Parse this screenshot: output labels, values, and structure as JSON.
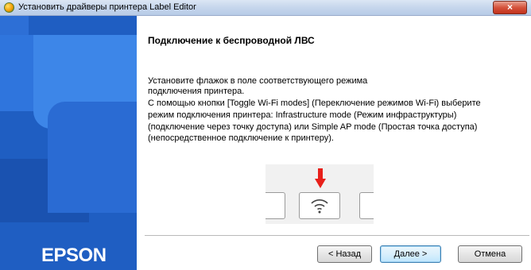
{
  "window": {
    "title": "Установить драйверы принтера Label Editor",
    "close_glyph": "×"
  },
  "sidebar": {
    "brand": "EPSON",
    "accent_color": "#1f5ec2"
  },
  "content": {
    "heading": "Подключение к беспроводной ЛВС",
    "lines": [
      "Установите флажок в поле соответствующего режима",
      "подключения принтера.",
      "С помощью кнопки [Toggle Wi-Fi modes] (Переключение режимов Wi-Fi) выберите",
      "режим подключения принтера: Infrastructure mode (Режим инфраструктуры)",
      "(подключение через точку доступа) или Simple AP mode (Простая точка доступа)",
      "(непосредственное подключение к принтеру)."
    ],
    "illustration": {
      "arrow_icon": "down-arrow-icon",
      "button_icon": "wifi-icon",
      "arrow_color": "#e8201a"
    }
  },
  "buttons": {
    "back": "< Назад",
    "next": "Далее >",
    "cancel": "Отмена"
  }
}
